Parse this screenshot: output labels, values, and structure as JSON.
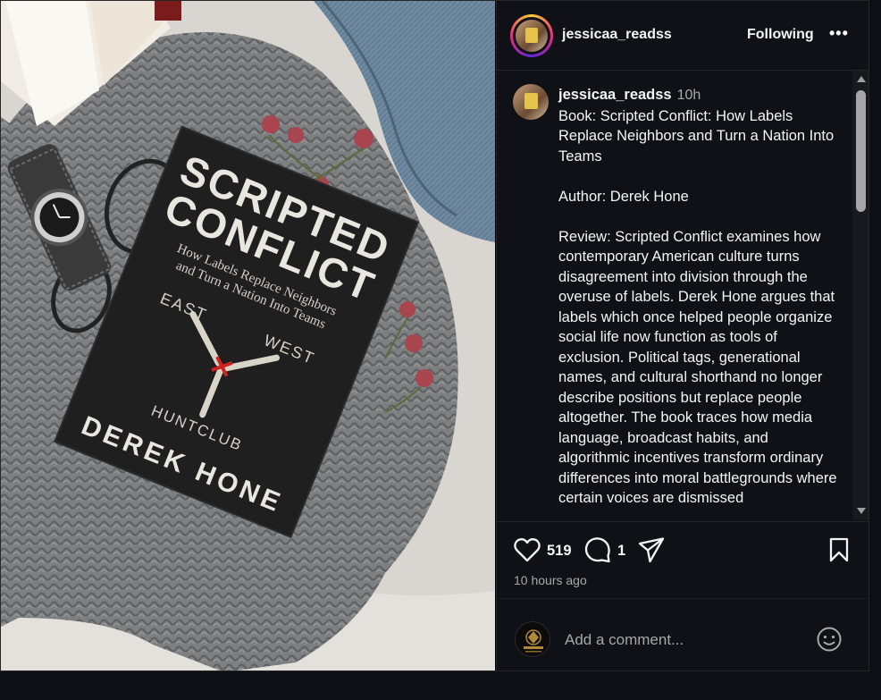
{
  "header": {
    "username": "jessicaa_readss",
    "follow_label": "Following",
    "more_label": "•••"
  },
  "caption": {
    "username": "jessicaa_readss",
    "time": "10h",
    "text": "Book: Scripted Conflict: How Labels Replace Neighbors and Turn a Nation Into Teams\n\nAuthor: Derek Hone\n\nReview: Scripted Conflict examines how contemporary American culture turns disagreement into division through the overuse of labels. Derek Hone argues that labels which once helped people organize social life now function as tools of exclusion. Political tags, generational names, and cultural shorthand no longer describe positions but replace people altogether. The book traces how media language, broadcast habits, and algorithmic incentives transform ordinary differences into moral battlegrounds where certain voices are dismissed"
  },
  "photo": {
    "book_title_line1": "SCRIPTED",
    "book_title_line2": "CONFLICT",
    "book_subtitle_line1": "How Labels Replace Neighbors",
    "book_subtitle_line2": "and Turn a Nation Into Teams",
    "word_east": "EAST",
    "word_west": "WEST",
    "word_huntclub": "HUNTCLUB",
    "book_author": "DEREK HONE"
  },
  "actions": {
    "likes": "519",
    "comments": "1",
    "time_ago": "10 hours ago"
  },
  "comment_box": {
    "placeholder": "Add a comment..."
  },
  "icons": [
    "heart-icon",
    "comment-icon",
    "share-icon",
    "bookmark-icon",
    "emoji-icon",
    "more-icon"
  ]
}
